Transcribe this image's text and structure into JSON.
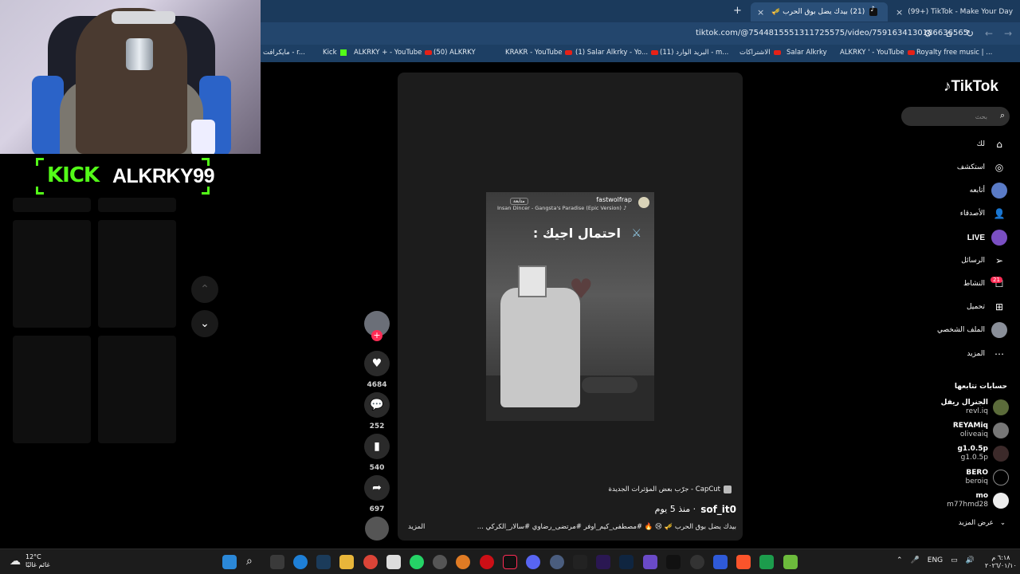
{
  "tabs": [
    {
      "label": "(99+) TikTok - Make Your Day",
      "active": false
    },
    {
      "label": "(21) بيدك يضل بوق الحرب 🎺 | ...",
      "active": true
    }
  ],
  "address": {
    "url": "tiktok.com/@7544815551311725575/video/7591634130186636565"
  },
  "bookmarks": [
    {
      "label": "Royalty free music | ...",
      "icon": "generic-icon"
    },
    {
      "label": "ALKRKY ' - YouTube",
      "icon": "youtube-icon"
    },
    {
      "label": "Salar Alkrky",
      "icon": "facebook-icon"
    },
    {
      "label": "الاشتراكات",
      "icon": "youtube-icon"
    },
    {
      "label": "البريد الوارد (11) - m...",
      "icon": "gmail-icon"
    },
    {
      "label": "(1) Salar Alkrky - Yo...",
      "icon": "youtube-icon"
    },
    {
      "label": "KRAKR - YouTube",
      "icon": "youtube-icon"
    },
    {
      "label": "(50) ALKRKY",
      "icon": "reddit-icon"
    },
    {
      "label": "ALKRKY + - YouTube",
      "icon": "kick-icon"
    },
    {
      "label": "Kick",
      "icon": "kick-icon"
    },
    {
      "label": "مايكرافت - r...",
      "icon": "generic-icon"
    }
  ],
  "overlay": {
    "brand": "KICK",
    "username": "ALKRKY99"
  },
  "video": {
    "clip_user": "fastwolfrap",
    "clip_follow": "متابعة",
    "clip_song": "Insan Dincer - Gangsta's Paradise (Epic Version) ♪",
    "clip_caption": "احتمال اجيك :",
    "likes": "4684",
    "comments": "252",
    "saves": "540",
    "shares": "697",
    "capcut": "CapCut - جرّب بعض المؤثرات الجديدة",
    "author": "sof_it0",
    "posted": "· منذ 5 يوم",
    "description": "بيدك يضل بوق الحرب 🎺 😢 🔥 #مصطفى_كيم_اوفر #مرتضى_رضاوي #سالار_الكركي ...",
    "more": "المزيد"
  },
  "sidebar": {
    "logo": "TikTok",
    "search_placeholder": "بحث",
    "nav": [
      {
        "label": "لك",
        "icon": "home-icon"
      },
      {
        "label": "استكشف",
        "icon": "compass-icon"
      },
      {
        "label": "أتابعه",
        "icon": "avatar-icon"
      },
      {
        "label": "الأصدقاء",
        "icon": "friends-icon"
      },
      {
        "label": "LIVE",
        "icon": "live-icon"
      },
      {
        "label": "الرسائل",
        "icon": "send-icon"
      },
      {
        "label": "النشاط",
        "icon": "inbox-icon"
      },
      {
        "label": "تحميل",
        "icon": "upload-icon"
      },
      {
        "label": "الملف الشخصي",
        "icon": "profile-icon"
      },
      {
        "label": "المزيد",
        "icon": "more-icon"
      }
    ],
    "activity_badge": "21",
    "following_heading": "حسابات تتابعها",
    "following": [
      {
        "name": "الجنرال ريفل",
        "handle": "revl.iq"
      },
      {
        "name": "REYAMiq",
        "handle": "oliveaiq"
      },
      {
        "name": "g1.0.5p",
        "handle": "g1.0.5p"
      },
      {
        "name": "BERO",
        "handle": "beroiq"
      },
      {
        "name": "mo",
        "handle": "m77hmd28"
      }
    ],
    "see_more": "عرض المزيد"
  },
  "taskbar": {
    "temp": "12°C",
    "weather_text": "غائم غالبًا",
    "lang": "ENG",
    "time": "٦:١٨ م",
    "date": "٢٠٢٦/٠١/١٠"
  }
}
